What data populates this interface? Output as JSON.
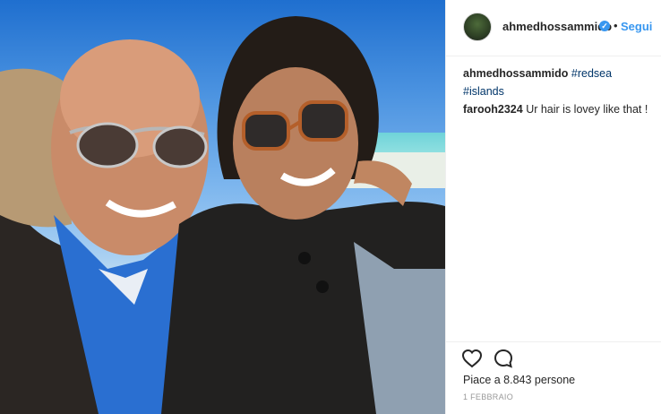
{
  "post": {
    "photo_alt": "Selfie of two smiling men wearing sunglasses by the sea",
    "photo_icon": "photo-image"
  },
  "header": {
    "username": "ahmedhossammido",
    "verified_icon": "verified-badge-icon",
    "separator": "•",
    "follow_label": "Segui"
  },
  "caption": {
    "username": "ahmedhossammido",
    "tags": [
      "#redsea",
      "#islands"
    ]
  },
  "comments": [
    {
      "username": "farooh2324",
      "text": "Ur hair is lovey like that !"
    }
  ],
  "actions": {
    "like_icon": "heart-icon",
    "comment_icon": "comment-icon"
  },
  "likes_text": "Piace a 8.843 persone",
  "date_text": "1 FEBBRAIO",
  "colors": {
    "accent": "#3897f0",
    "hashtag": "#003569",
    "muted": "#999999"
  }
}
